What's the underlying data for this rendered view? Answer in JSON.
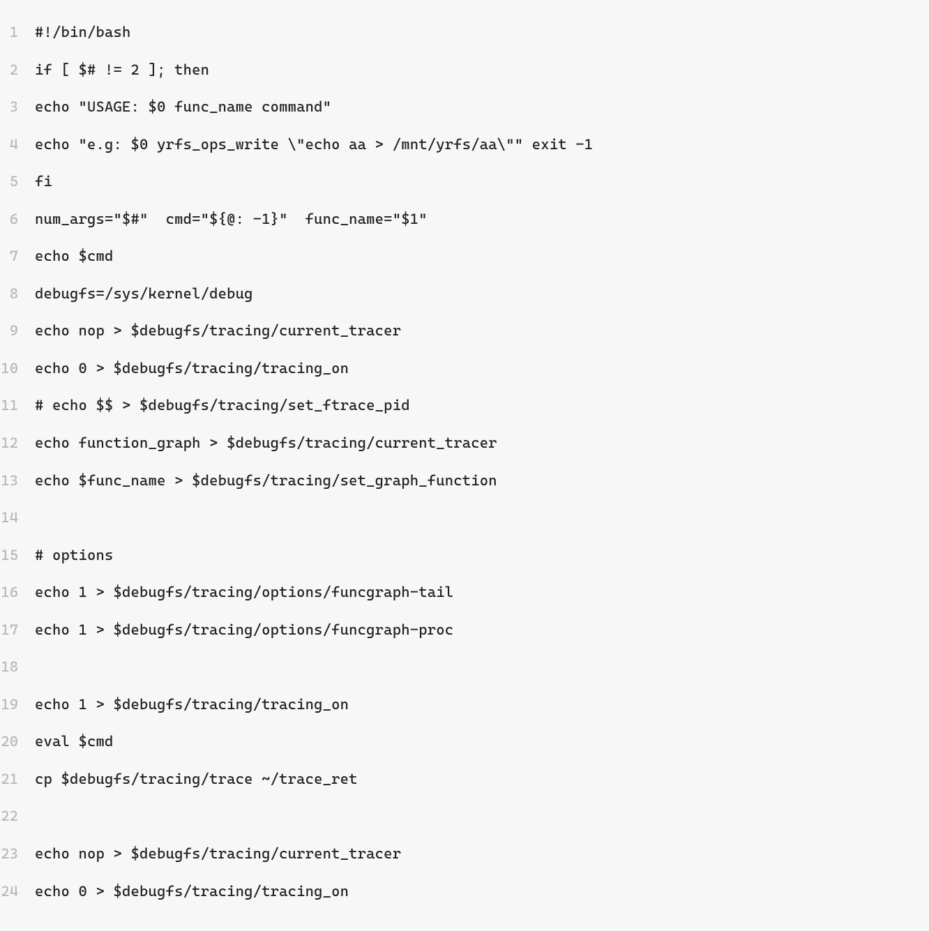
{
  "code": {
    "lines": [
      {
        "n": "1",
        "text": "#!/bin/bash"
      },
      {
        "n": "2",
        "text": "if [ $# != 2 ]; then"
      },
      {
        "n": "3",
        "text": "echo \"USAGE: $0 func_name command\""
      },
      {
        "n": "4",
        "text": "echo \"e.g: $0 yrfs_ops_write \\\"echo aa > /mnt/yrfs/aa\\\"\" exit -1"
      },
      {
        "n": "5",
        "text": "fi"
      },
      {
        "n": "6",
        "text": "num_args=\"$#\"  cmd=\"${@: -1}\"  func_name=\"$1\""
      },
      {
        "n": "7",
        "text": "echo $cmd"
      },
      {
        "n": "8",
        "text": "debugfs=/sys/kernel/debug"
      },
      {
        "n": "9",
        "text": "echo nop > $debugfs/tracing/current_tracer"
      },
      {
        "n": "10",
        "text": "echo 0 > $debugfs/tracing/tracing_on"
      },
      {
        "n": "11",
        "text": "# echo $$ > $debugfs/tracing/set_ftrace_pid"
      },
      {
        "n": "12",
        "text": "echo function_graph > $debugfs/tracing/current_tracer"
      },
      {
        "n": "13",
        "text": "echo $func_name > $debugfs/tracing/set_graph_function"
      },
      {
        "n": "14",
        "text": ""
      },
      {
        "n": "15",
        "text": "# options"
      },
      {
        "n": "16",
        "text": "echo 1 > $debugfs/tracing/options/funcgraph-tail"
      },
      {
        "n": "17",
        "text": "echo 1 > $debugfs/tracing/options/funcgraph-proc"
      },
      {
        "n": "18",
        "text": ""
      },
      {
        "n": "19",
        "text": "echo 1 > $debugfs/tracing/tracing_on"
      },
      {
        "n": "20",
        "text": "eval $cmd"
      },
      {
        "n": "21",
        "text": "cp $debugfs/tracing/trace ~/trace_ret"
      },
      {
        "n": "22",
        "text": ""
      },
      {
        "n": "23",
        "text": "echo nop > $debugfs/tracing/current_tracer"
      },
      {
        "n": "24",
        "text": "echo 0 > $debugfs/tracing/tracing_on"
      }
    ]
  }
}
